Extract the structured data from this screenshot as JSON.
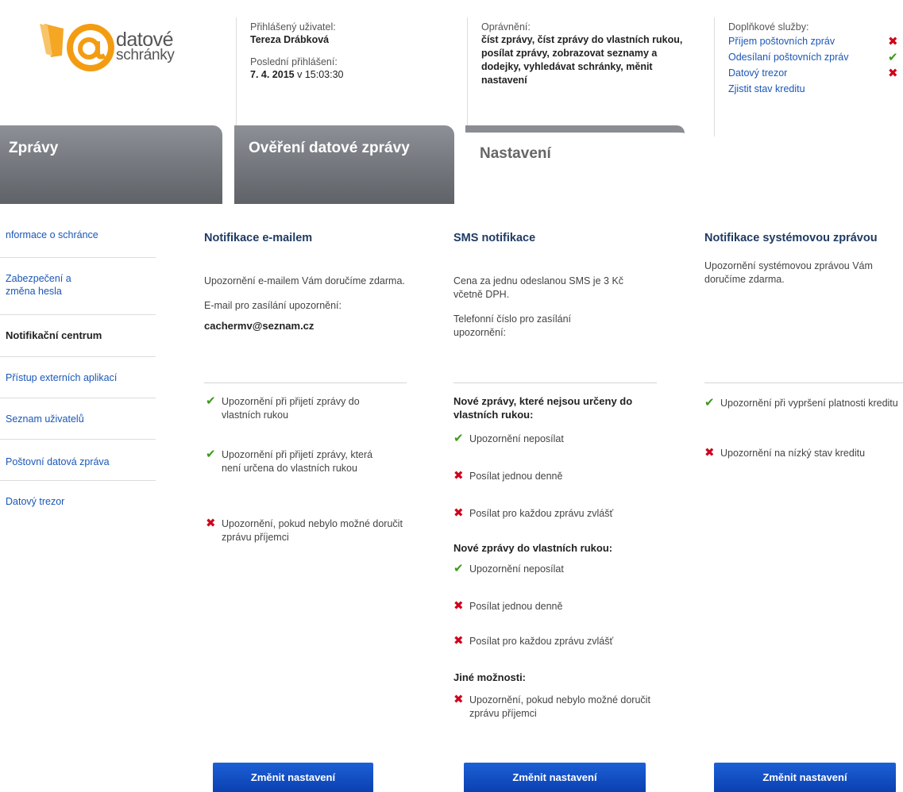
{
  "logo": {
    "line1": "datové",
    "line2": "schránky"
  },
  "user": {
    "label": "Přihlášený uživatel:",
    "name": "Tereza Drábková",
    "last_login_label": "Poslední přihlášení:",
    "last_login_date": "7. 4. 2015",
    "last_login_time": "v 15:03:30"
  },
  "permissions": {
    "label": "Oprávnění:",
    "value": "číst zprávy, číst zprávy do vlastních rukou, posílat zprávy, zobrazovat seznamy a dodejky, vyhledávat schránky, měnit nastavení"
  },
  "services": {
    "label": "Doplňkové služby:",
    "items": [
      {
        "label": "Příjem poštovních zpráv",
        "status": "✖"
      },
      {
        "label": "Odesílaní poštovních zpráv",
        "status": "✔"
      },
      {
        "label": "Datový trezor",
        "status": "✖"
      },
      {
        "label": "Zjistit stav kreditu",
        "status": ""
      }
    ]
  },
  "tabs": [
    {
      "label": "Zprávy"
    },
    {
      "label": "Ověření datové zprávy"
    },
    {
      "label": "Nastavení"
    }
  ],
  "sidebar": {
    "items": [
      {
        "label": "nformace o schránce"
      },
      {
        "label": "Zabezpečení a změna hesla"
      },
      {
        "label": "Notifikační centrum"
      },
      {
        "label": "Přístup externích aplikací"
      },
      {
        "label": "Seznam uživatelů"
      },
      {
        "label": "Poštovní datová zpráva"
      },
      {
        "label": "Datový trezor"
      }
    ]
  },
  "email": {
    "title": "Notifikace e-mailem",
    "desc": "Upozornění e-mailem Vám doručíme zdarma.",
    "addr_label": "E-mail pro zasílání upozornění:",
    "addr": "cachermv@seznam.cz",
    "options": [
      {
        "icon": "✔",
        "label": "Upozornění při přijetí zprávy do vlastních rukou"
      },
      {
        "icon": "✔",
        "label": "Upozornění při přijetí zprávy, která není určena do vlastních rukou"
      },
      {
        "icon": "✖",
        "label": "Upozornění, pokud nebylo možné doručit zprávu příjemci"
      }
    ],
    "button": "Změnit nastavení"
  },
  "sms": {
    "title": "SMS notifikace",
    "desc": "Cena za jednu odeslanou SMS je 3 Kč včetně DPH.",
    "phone_label": "Telefonní číslo pro zasílání upozornění:",
    "group1": "Nové zprávy, které nejsou určeny do vlastních rukou:",
    "group1_options": [
      {
        "icon": "✔",
        "label": "Upozornění neposílat"
      },
      {
        "icon": "✖",
        "label": "Posílat jednou denně"
      },
      {
        "icon": "✖",
        "label": "Posílat pro každou zprávu zvlášť"
      }
    ],
    "group2": "Nové zprávy do vlastních rukou:",
    "group2_options": [
      {
        "icon": "✔",
        "label": "Upozornění neposílat"
      },
      {
        "icon": "✖",
        "label": "Posílat jednou denně"
      },
      {
        "icon": "✖",
        "label": "Posílat pro každou zprávu zvlášť"
      }
    ],
    "group3": "Jiné možnosti:",
    "group3_options": [
      {
        "icon": "✖",
        "label": "Upozornění, pokud nebylo možné doručit zprávu příjemci"
      }
    ],
    "button": "Změnit nastavení"
  },
  "system": {
    "title": "Notifikace systémovou zprávou",
    "desc": "Upozornění systémovou zprávou Vám doručíme zdarma.",
    "options": [
      {
        "icon": "✔",
        "label": "Upozornění při vypršení platnosti kreditu"
      },
      {
        "icon": "✖",
        "label": "Upozornění na nízký stav kreditu"
      }
    ],
    "button": "Změnit nastavení"
  },
  "colors": {
    "accent": "#1a57b8",
    "button": "#0a3fb0",
    "check": "#3c9a1b",
    "cross": "#d0021b"
  }
}
